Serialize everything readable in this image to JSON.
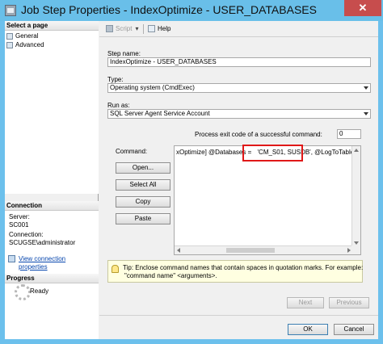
{
  "window": {
    "title": "Job Step Properties - IndexOptimize - USER_DATABASES",
    "close_glyph": "✕"
  },
  "sidebar": {
    "select_page_header": "Select a page",
    "items": [
      {
        "label": "General"
      },
      {
        "label": "Advanced"
      }
    ],
    "connection_header": "Connection",
    "server_label": "Server:",
    "server_value": "SC001",
    "connection_label": "Connection:",
    "connection_value": "SCUGSE\\administrator",
    "view_link_line1": "View connection",
    "view_link_line2": "properties",
    "progress_header": "Progress",
    "progress_status": "Ready"
  },
  "toolbar": {
    "script_label": "Script",
    "help_label": "Help"
  },
  "form": {
    "step_name_label": "Step name:",
    "step_name_value": "IndexOptimize - USER_DATABASES",
    "type_label": "Type:",
    "type_value": "Operating system (CmdExec)",
    "run_as_label": "Run as:",
    "run_as_value": "SQL Server Agent Service Account",
    "exit_code_label": "Process exit code of a successful command:",
    "exit_code_value": "0",
    "command_label": "Command:",
    "command_part1": "xOptimize] @Databases =",
    "command_highlight": "'CM_S01, SUSDB'",
    "command_part2": ", @LogToTable = 'Y'\" -b"
  },
  "buttons": {
    "open": "Open...",
    "select_all": "Select All",
    "copy": "Copy",
    "paste": "Paste",
    "next": "Next",
    "previous": "Previous",
    "ok": "OK",
    "cancel": "Cancel"
  },
  "tip": {
    "line1": "Tip: Enclose command names that contain spaces in quotation marks. For example:",
    "line2": "\"command name\" <arguments>."
  },
  "colors": {
    "title_bar": "#69bfe9",
    "close_button": "#c74d4d",
    "highlight_box": "#e01818",
    "tip_background": "#ffffe1"
  }
}
